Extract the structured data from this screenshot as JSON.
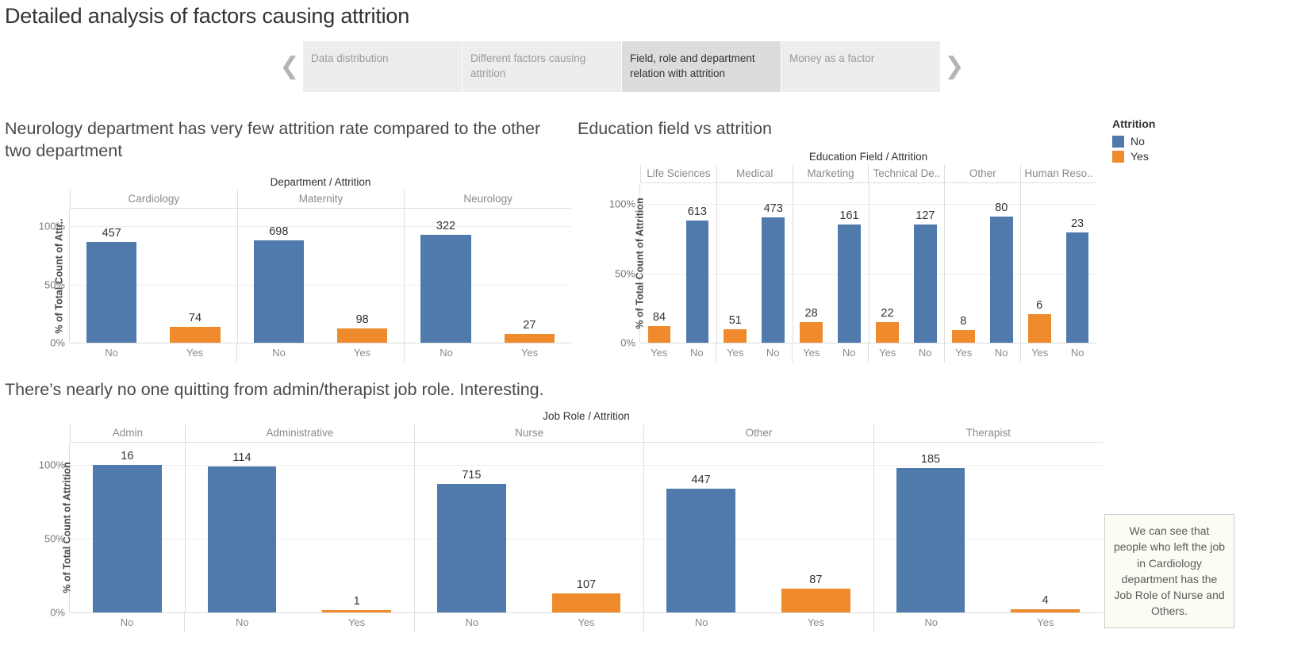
{
  "header": {
    "title": "Detailed analysis of factors causing attrition",
    "prev_icon": "chevron-left-icon",
    "next_icon": "chevron-right-icon",
    "tabs": [
      {
        "label": "Data distribution",
        "active": false
      },
      {
        "label": "Different factors causing attrition",
        "active": false
      },
      {
        "label": "Field, role and department relation with attrition",
        "active": true
      },
      {
        "label": "Money as a factor",
        "active": false
      }
    ]
  },
  "legend": {
    "title": "Attrition",
    "items": [
      {
        "label": "No",
        "color": "#4f7aab"
      },
      {
        "label": "Yes",
        "color": "#ef8b2c"
      }
    ]
  },
  "annotation": {
    "text": "We can see that people who left the job in Cardiology department has the Job Role of Nurse and Others."
  },
  "panels": {
    "department": {
      "title": "Neurology department has very few attrition rate compared to the other two department"
    },
    "education": {
      "title": "Education field vs attrition"
    },
    "jobrole": {
      "title": "There’s nearly no one quitting from admin/therapist job role. Interesting."
    }
  },
  "chart_data": [
    {
      "id": "department",
      "type": "bar",
      "title": "Department / Attrition",
      "xlabel": "",
      "ylabel": "% of Total Count of Attr..",
      "ylim": [
        0,
        115
      ],
      "yticks": [
        "0%",
        "50%",
        "100%"
      ],
      "ytick_values": [
        0,
        50,
        100
      ],
      "grid": true,
      "legend_position": "right",
      "groups": [
        {
          "name": "Cardiology",
          "bars": [
            {
              "category": "No",
              "series": "No",
              "label": "457",
              "value": 457,
              "percent": 86.1
            },
            {
              "category": "Yes",
              "series": "Yes",
              "label": "74",
              "value": 74,
              "percent": 13.9
            }
          ]
        },
        {
          "name": "Maternity",
          "bars": [
            {
              "category": "No",
              "series": "No",
              "label": "698",
              "value": 698,
              "percent": 87.7
            },
            {
              "category": "Yes",
              "series": "Yes",
              "label": "98",
              "value": 98,
              "percent": 12.3
            }
          ]
        },
        {
          "name": "Neurology",
          "bars": [
            {
              "category": "No",
              "series": "No",
              "label": "322",
              "value": 322,
              "percent": 92.3
            },
            {
              "category": "Yes",
              "series": "Yes",
              "label": "27",
              "value": 27,
              "percent": 7.7
            }
          ]
        }
      ]
    },
    {
      "id": "education",
      "type": "bar",
      "title": "Education Field / Attrition",
      "xlabel": "",
      "ylabel": "% of Total Count of Attrition",
      "ylim": [
        0,
        115
      ],
      "yticks": [
        "0%",
        "50%",
        "100%"
      ],
      "ytick_values": [
        0,
        50,
        100
      ],
      "grid": true,
      "legend_position": "right",
      "groups": [
        {
          "name": "Life Sciences",
          "bars": [
            {
              "category": "Yes",
              "series": "Yes",
              "label": "84",
              "value": 84,
              "percent": 12.0
            },
            {
              "category": "No",
              "series": "No",
              "label": "613",
              "value": 613,
              "percent": 88.0
            }
          ]
        },
        {
          "name": "Medical",
          "bars": [
            {
              "category": "Yes",
              "series": "Yes",
              "label": "51",
              "value": 51,
              "percent": 9.7
            },
            {
              "category": "No",
              "series": "No",
              "label": "473",
              "value": 473,
              "percent": 90.3
            }
          ]
        },
        {
          "name": "Marketing",
          "bars": [
            {
              "category": "Yes",
              "series": "Yes",
              "label": "28",
              "value": 28,
              "percent": 14.8
            },
            {
              "category": "No",
              "series": "No",
              "label": "161",
              "value": 161,
              "percent": 85.2
            }
          ]
        },
        {
          "name": "Technical De..",
          "bars": [
            {
              "category": "Yes",
              "series": "Yes",
              "label": "22",
              "value": 22,
              "percent": 14.8
            },
            {
              "category": "No",
              "series": "No",
              "label": "127",
              "value": 127,
              "percent": 85.2
            }
          ]
        },
        {
          "name": "Other",
          "bars": [
            {
              "category": "Yes",
              "series": "Yes",
              "label": "8",
              "value": 8,
              "percent": 9.1
            },
            {
              "category": "No",
              "series": "No",
              "label": "80",
              "value": 80,
              "percent": 90.9
            }
          ]
        },
        {
          "name": "Human Reso..",
          "bars": [
            {
              "category": "Yes",
              "series": "Yes",
              "label": "6",
              "value": 6,
              "percent": 20.7
            },
            {
              "category": "No",
              "series": "No",
              "label": "23",
              "value": 23,
              "percent": 79.3
            }
          ]
        }
      ]
    },
    {
      "id": "jobrole",
      "type": "bar",
      "title": "Job Role / Attrition",
      "xlabel": "",
      "ylabel": "% of Total Count of Attrition",
      "ylim": [
        0,
        115
      ],
      "yticks": [
        "0%",
        "50%",
        "100%"
      ],
      "ytick_values": [
        0,
        50,
        100
      ],
      "grid": true,
      "legend_position": "right",
      "groups": [
        {
          "name": "Admin",
          "bars": [
            {
              "category": "No",
              "series": "No",
              "label": "16",
              "value": 16,
              "percent": 100.0
            }
          ]
        },
        {
          "name": "Administrative",
          "bars": [
            {
              "category": "No",
              "series": "No",
              "label": "114",
              "value": 114,
              "percent": 99.1
            },
            {
              "category": "Yes",
              "series": "Yes",
              "label": "1",
              "value": 1,
              "percent": 0.9
            }
          ]
        },
        {
          "name": "Nurse",
          "bars": [
            {
              "category": "No",
              "series": "No",
              "label": "715",
              "value": 715,
              "percent": 87.0
            },
            {
              "category": "Yes",
              "series": "Yes",
              "label": "107",
              "value": 107,
              "percent": 13.0
            }
          ]
        },
        {
          "name": "Other",
          "bars": [
            {
              "category": "No",
              "series": "No",
              "label": "447",
              "value": 447,
              "percent": 83.7
            },
            {
              "category": "Yes",
              "series": "Yes",
              "label": "87",
              "value": 87,
              "percent": 16.3
            }
          ]
        },
        {
          "name": "Therapist",
          "bars": [
            {
              "category": "No",
              "series": "No",
              "label": "185",
              "value": 185,
              "percent": 97.9
            },
            {
              "category": "Yes",
              "series": "Yes",
              "label": "4",
              "value": 4,
              "percent": 2.1
            }
          ]
        }
      ]
    }
  ]
}
